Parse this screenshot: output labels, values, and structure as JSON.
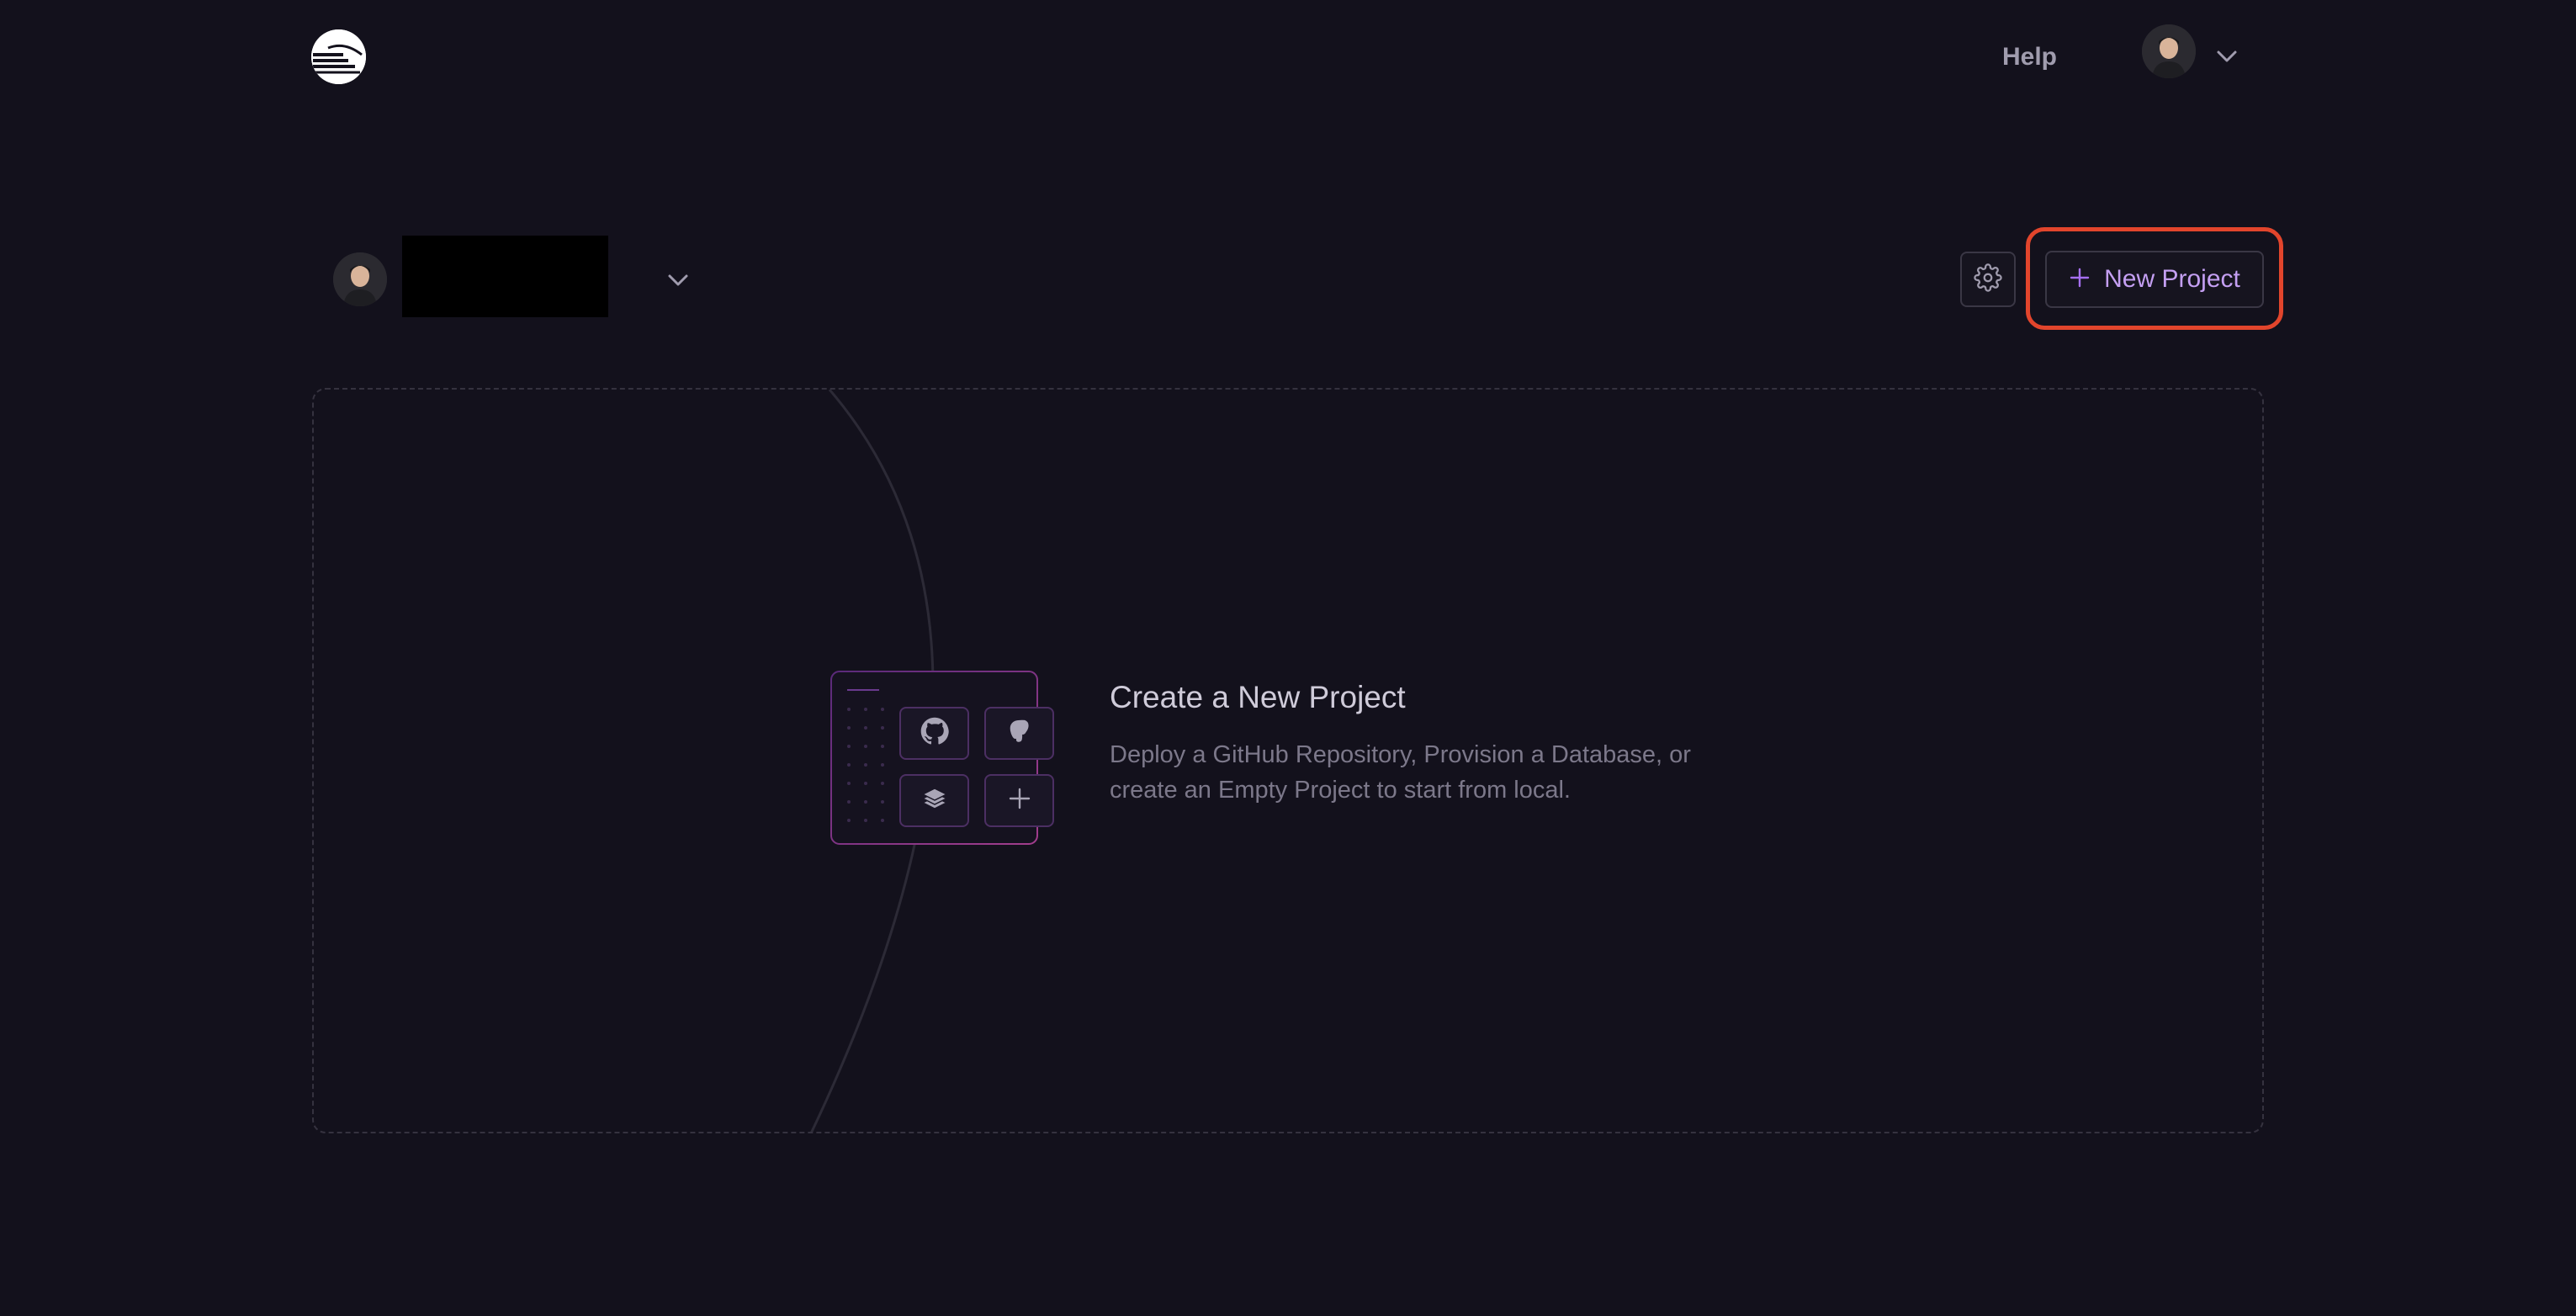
{
  "nav": {
    "logo_icon": "railway-logo-icon",
    "help_label": "Help",
    "account_chevron_icon": "chevron-down-icon"
  },
  "workspace": {
    "name": "",
    "chevron_icon": "chevron-down-icon"
  },
  "toolbar": {
    "settings_icon": "gear-icon",
    "new_project_label": "New Project",
    "new_project_icon": "plus-icon"
  },
  "empty_state": {
    "title": "Create a New Project",
    "description": "Deploy a GitHub Repository, Provision a Database, or create an Empty Project to start from local.",
    "tiles": [
      "github-icon",
      "postgres-icon",
      "stack-icon",
      "plus-icon"
    ]
  },
  "colors": {
    "background": "#13111c",
    "accent": "#c49ff2",
    "highlight": "#e2452c",
    "border": "#3a3745"
  }
}
